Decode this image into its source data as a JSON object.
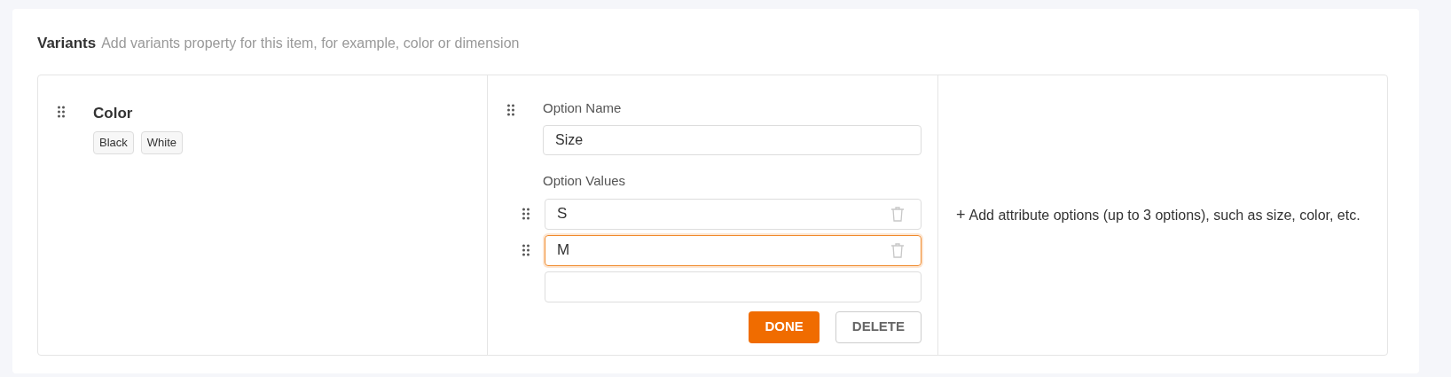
{
  "header": {
    "title": "Variants",
    "description": "Add variants property for this item, for example, color or dimension"
  },
  "saved_option": {
    "name": "Color",
    "values": [
      "Black",
      "White"
    ]
  },
  "editing_option": {
    "name_label": "Option Name",
    "name_value": "Size",
    "values_label": "Option Values",
    "values": [
      {
        "value": "S",
        "focused": false
      },
      {
        "value": "M",
        "focused": true
      },
      {
        "focused": false
      }
    ],
    "buttons": [
      {
        "label": "DONE",
        "kind": "primary"
      },
      {
        "label": "DELETE",
        "kind": "secondary"
      }
    ]
  },
  "add_option": {
    "icon": "+",
    "text": "Add attribute options (up to 3 options), such as size, color, etc."
  }
}
